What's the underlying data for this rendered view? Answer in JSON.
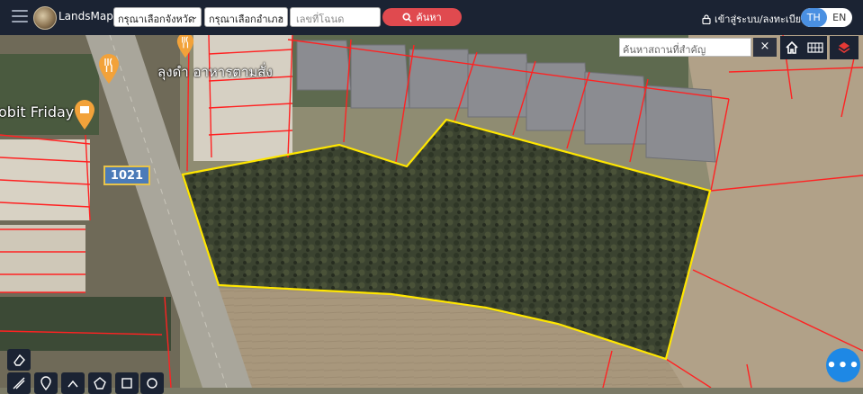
{
  "header": {
    "brand": "LandsMaps",
    "province_select": "กรุณาเลือกจังหวัด",
    "district_select": "กรุณาเลือกอำเภอ",
    "deed_input_placeholder": "เลขที่โฉนด",
    "search_button": "ค้นหา",
    "login_label": "เข้าสู่ระบบ/ลงทะเบียน",
    "lang_th": "TH",
    "lang_en": "EN"
  },
  "map": {
    "place_search_placeholder": "ค้นหาสถานที่สำคัญ",
    "clear_label": "×",
    "labels": {
      "restaurant": "ลุงดำ อาหารตามสั่ง",
      "store": "obit Friday",
      "road_number": "1021"
    },
    "colors": {
      "parcel_border": "#ff2222",
      "selected_parcel": "#ffe600",
      "poi_marker": "#f2a23a"
    }
  },
  "tools": [
    "eraser-icon",
    "ruler-icon",
    "pin-icon",
    "measure-icon",
    "polygon-icon",
    "rectangle-icon",
    "circle-icon"
  ],
  "fab_label": "•••"
}
